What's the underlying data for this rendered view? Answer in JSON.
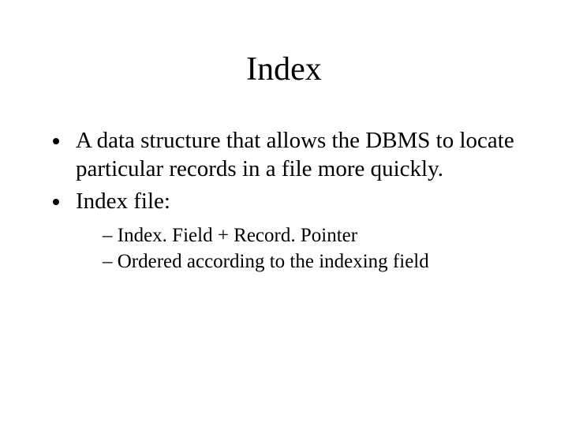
{
  "title": "Index",
  "bullets": {
    "b1": "A data structure that allows the DBMS to locate particular records in a file more quickly.",
    "b2": "Index file:",
    "sub1": "Index. Field + Record. Pointer",
    "sub2": "Ordered according to the indexing field"
  }
}
